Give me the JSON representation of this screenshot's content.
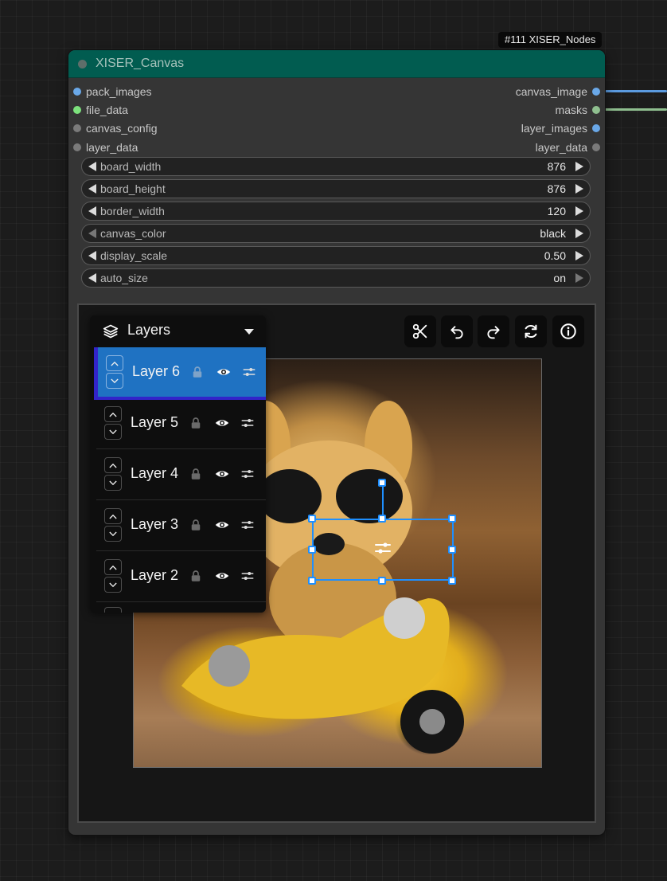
{
  "badge": "#111 XISER_Nodes",
  "node": {
    "title": "XISER_Canvas",
    "inputs": [
      {
        "label": "pack_images",
        "color": "#6aa8e8"
      },
      {
        "label": "file_data",
        "color": "#7de27d"
      },
      {
        "label": "canvas_config",
        "color": "#7a7a7a"
      },
      {
        "label": "layer_data",
        "color": "#7a7a7a"
      }
    ],
    "outputs": [
      {
        "label": "canvas_image",
        "color": "#6aa8e8"
      },
      {
        "label": "masks",
        "color": "#8fbf8f"
      },
      {
        "label": "layer_images",
        "color": "#6aa8e8"
      },
      {
        "label": "layer_data",
        "color": "#7a7a7a"
      }
    ],
    "widgets": [
      {
        "name": "board_width",
        "value": "876"
      },
      {
        "name": "board_height",
        "value": "876"
      },
      {
        "name": "border_width",
        "value": "120"
      },
      {
        "name": "canvas_color",
        "value": "black"
      },
      {
        "name": "display_scale",
        "value": "0.50"
      },
      {
        "name": "auto_size",
        "value": "on"
      }
    ]
  },
  "toolbar": {
    "icons": [
      "scissors-icon",
      "undo-icon",
      "redo-icon",
      "reset-icon",
      "info-icon"
    ]
  },
  "layers_panel": {
    "title": "Layers",
    "layers": [
      {
        "name": "Layer 6",
        "active": true
      },
      {
        "name": "Layer 5",
        "active": false
      },
      {
        "name": "Layer 4",
        "active": false
      },
      {
        "name": "Layer 3",
        "active": false
      },
      {
        "name": "Layer 2",
        "active": false
      }
    ]
  },
  "colors": {
    "header": "#015c50",
    "selection": "#1e8fff",
    "active_layer": "#1f72c2"
  }
}
